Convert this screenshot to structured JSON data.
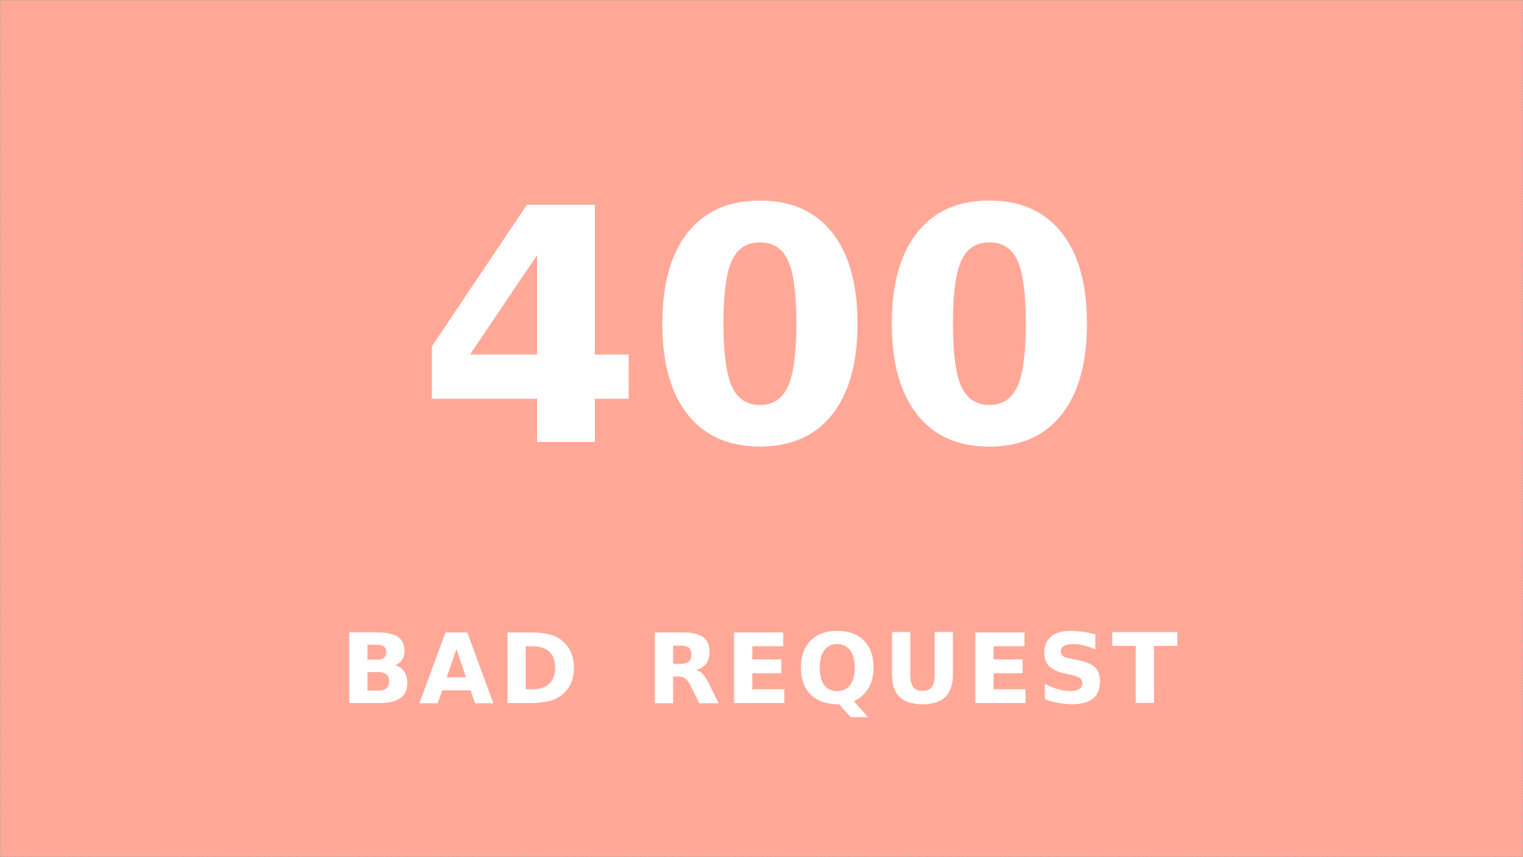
{
  "error": {
    "code": "400",
    "message": "BAD REQUEST"
  },
  "colors": {
    "background": "#ffa898",
    "text": "#ffffff"
  }
}
